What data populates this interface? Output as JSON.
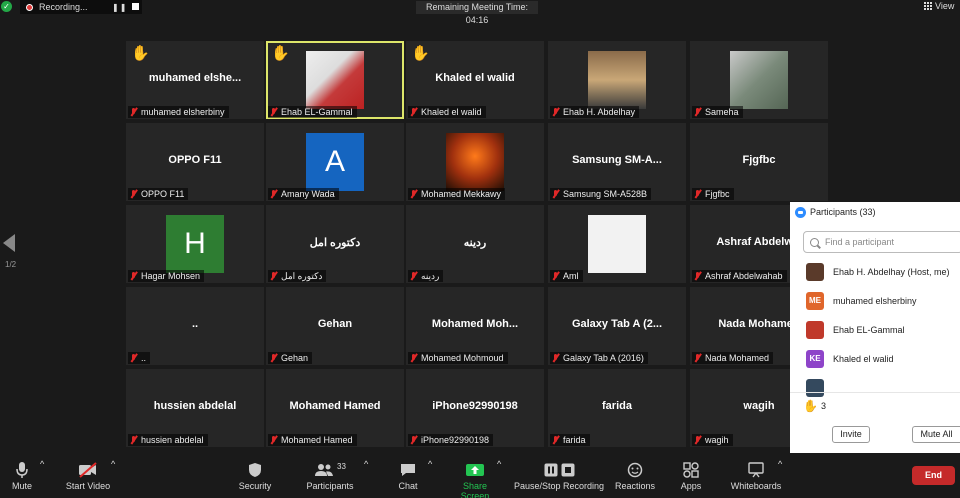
{
  "top_bar": {
    "recording_label": "Recording...",
    "meeting_time": "Remaining Meeting Time: 04:16",
    "view_label": "View"
  },
  "pager": {
    "page": "1/2"
  },
  "tiles": [
    {
      "big": "muhamed  elshe...",
      "label": "muhamed elsherbiny",
      "hand": true
    },
    {
      "big": "",
      "label": "Ehab EL-Gammal",
      "hand": true,
      "active": true,
      "photo": "ehab-el-gammal"
    },
    {
      "big": "Khaled el walid",
      "label": "Khaled el walid",
      "hand": true
    },
    {
      "big": "",
      "label": "Ehab H. Abdelhay",
      "photo": "ehab-abdelhay"
    },
    {
      "big": "",
      "label": "Sameha",
      "photo": "sameha"
    },
    {
      "big": "OPPO F11",
      "label": "OPPO F11"
    },
    {
      "big": "",
      "label": "Amany Wada",
      "avatar": "A",
      "avatar_color": "#1565c0"
    },
    {
      "big": "",
      "label": "Mohamed Mekkawy",
      "photo": "mekkawy"
    },
    {
      "big": "Samsung  SM-A...",
      "label": "Samsung SM-A528B"
    },
    {
      "big": "Fjgfbc",
      "label": "Fjgfbc"
    },
    {
      "big": "",
      "label": "Hagar Mohsen",
      "avatar": "H",
      "avatar_color": "#2e7d32"
    },
    {
      "big": "دكتوره  امل",
      "label": "دكتوره امل"
    },
    {
      "big": "ردينه",
      "label": "ردينه"
    },
    {
      "big": "",
      "label": "Aml",
      "avatar": "",
      "avatar_color": "#f2f2f2"
    },
    {
      "big": "Ashraf  Abdelw...",
      "label": "Ashraf Abdelwahab"
    },
    {
      "big": "..",
      "label": ".."
    },
    {
      "big": "Gehan",
      "label": "Gehan"
    },
    {
      "big": "Mohamed  Moh...",
      "label": "Mohamed Mohmoud"
    },
    {
      "big": "Galaxy Tab A (2...",
      "label": "Galaxy Tab A (2016)"
    },
    {
      "big": "Nada Mohamed",
      "label": "Nada Mohamed"
    },
    {
      "big": "hussien abdelal",
      "label": "hussien abdelal"
    },
    {
      "big": "Mohamed Hamed",
      "label": "Mohamed Hamed"
    },
    {
      "big": "iPhone92990198",
      "label": "iPhone92990198"
    },
    {
      "big": "farida",
      "label": "farida"
    },
    {
      "big": "wagih",
      "label": "wagih"
    }
  ],
  "participants_panel": {
    "title": "Participants (33)",
    "search_placeholder": "Find a participant",
    "items": [
      {
        "name": "Ehab H. Abdelhay (Host, me)",
        "initials": "",
        "color": "#5a3a2a"
      },
      {
        "name": "muhamed elsherbiny",
        "initials": "ME",
        "color": "#e0662b"
      },
      {
        "name": "Ehab EL-Gammal",
        "initials": "",
        "color": "#c0392b"
      },
      {
        "name": "Khaled el walid",
        "initials": "KE",
        "color": "#8e44c9"
      },
      {
        "name": "",
        "initials": "",
        "color": "#34495e"
      }
    ],
    "hands_count": "3",
    "invite_label": "Invite",
    "mute_all_label": "Mute All"
  },
  "toolbar": {
    "mute": "Mute",
    "start_video": "Start Video",
    "security": "Security",
    "participants": "Participants",
    "participants_count": "33",
    "chat": "Chat",
    "share_screen": "Share Screen",
    "pause_stop_recording": "Pause/Stop Recording",
    "reactions": "Reactions",
    "apps": "Apps",
    "whiteboards": "Whiteboards",
    "end": "End"
  },
  "colors": {
    "share_green": "#23c552",
    "end_red": "#c52a2a",
    "active_speaker": "#dde66a",
    "muted_red": "#e02828"
  }
}
